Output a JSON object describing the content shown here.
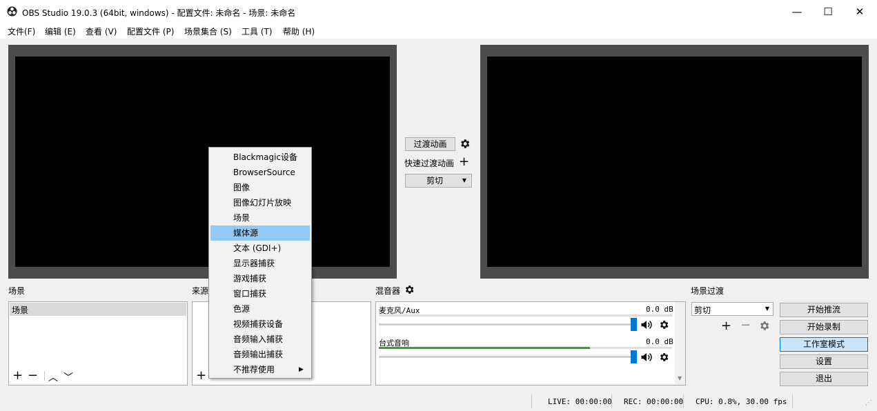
{
  "window": {
    "title": "OBS Studio 19.0.3 (64bit, windows) - 配置文件: 未命名 - 场景: 未命名",
    "minimize_glyph": "—",
    "maximize_glyph": "☐",
    "close_glyph": "✕"
  },
  "menubar": {
    "items": [
      "文件(F)",
      "编辑 (E)",
      "查看 (V)",
      "配置文件 (P)",
      "场景集合 (S)",
      "工具 (T)",
      "帮助 (H)"
    ]
  },
  "transitions_center": {
    "transition_button": "过渡动画",
    "quick_transition_label": "快速过渡动画",
    "cut_select": "剪切"
  },
  "scenes_panel": {
    "title": "场景",
    "items": [
      "场景"
    ]
  },
  "sources_panel": {
    "title": "来源"
  },
  "mixer_panel": {
    "title": "混音器",
    "channels": [
      {
        "name": "麦克风/Aux",
        "level": "0.0 dB",
        "meter_fill": 0.0,
        "volume": 1.0
      },
      {
        "name": "台式音响",
        "level": "0.0 dB",
        "meter_fill": 0.72,
        "volume": 1.0
      }
    ]
  },
  "scene_transition_panel": {
    "title": "场景过渡",
    "select": "剪切"
  },
  "controls": {
    "start_streaming": "开始推流",
    "start_recording": "开始录制",
    "studio_mode": "工作室模式",
    "settings": "设置",
    "exit": "退出"
  },
  "context_menu": {
    "items": [
      "Blackmagic设备",
      "BrowserSource",
      "图像",
      "图像幻灯片放映",
      "场景",
      "媒体源",
      "文本 (GDI+)",
      "显示器捕获",
      "游戏捕获",
      "窗口捕获",
      "色源",
      "视频捕获设备",
      "音频输入捕获",
      "音频输出捕获",
      "不推荐使用"
    ],
    "highlighted": "媒体源"
  },
  "statusbar": {
    "live": "LIVE: 00:00:00",
    "rec": "REC: 00:00:00",
    "cpu": "CPU: 0.8%, 30.00 fps"
  },
  "colors": {
    "meter_green": "#2aa52a",
    "slider_blue": "#0078d7",
    "highlight": "#91c9f7"
  }
}
